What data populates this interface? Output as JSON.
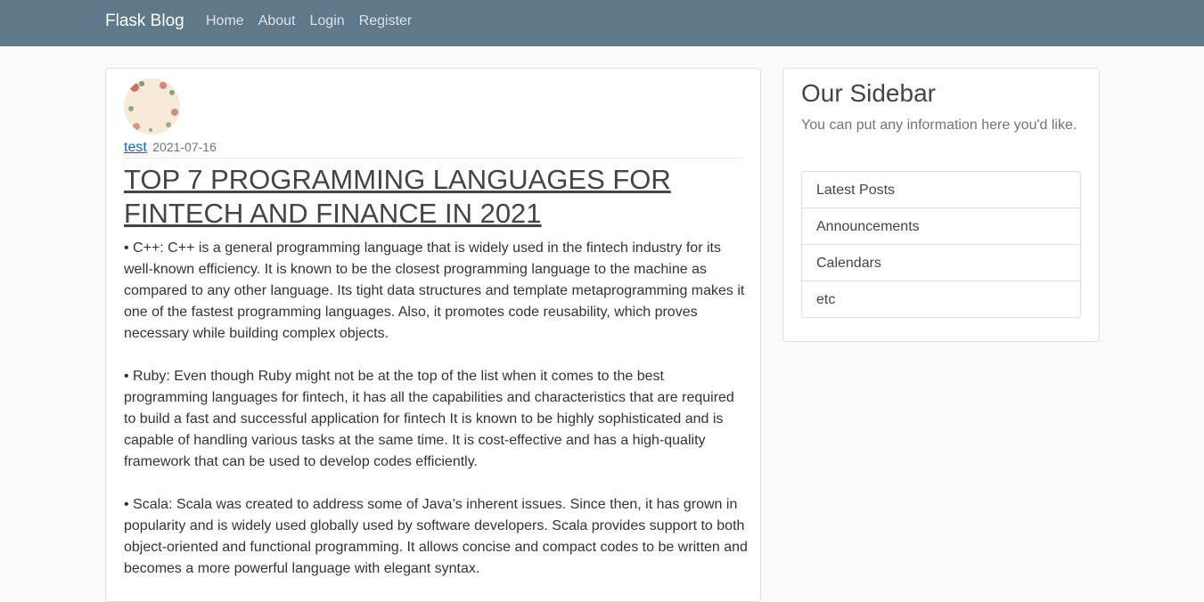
{
  "navbar": {
    "brand": "Flask Blog",
    "links": [
      "Home",
      "About",
      "Login",
      "Register"
    ]
  },
  "post": {
    "author": "test",
    "date": "2021-07-16",
    "title": "TOP 7 PROGRAMMING LANGUAGES FOR FINTECH AND FINANCE IN 2021",
    "paragraphs": [
      "• C++: C++ is a general programming language that is widely used in the fintech industry for its well-known efficiency. It is known to be the closest programming language to the machine as compared to any other language. Its tight data structures and template metaprogramming makes it one of the fastest programming languages. Also, it promotes code reusability, which proves necessary while building complex objects.",
      "• Ruby: Even though Ruby might not be at the top of the list when it comes to the best programming languages for fintech, it has all the capabilities and characteristics that are required to build a fast and successful application for fintech It is known to be highly sophisticated and is capable of handling various tasks at the same time. It is cost-effective and has a high-quality framework that can be used to develop codes efficiently.",
      "• Scala: Scala was created to address some of Java’s inherent issues. Since then, it has grown in popularity and is widely used globally used by software developers. Scala provides support to both object-oriented and functional programming. It allows concise and compact codes to be written and becomes a more powerful language with elegant syntax."
    ]
  },
  "sidebar": {
    "title": "Our Sidebar",
    "description": "You can put any information here you'd like.",
    "items": [
      "Latest Posts",
      "Announcements",
      "Calendars",
      "etc"
    ]
  },
  "colors": {
    "navbar_bg": "#5f788a",
    "link": "#0b6ad1",
    "page_bg": "#fafafa"
  }
}
